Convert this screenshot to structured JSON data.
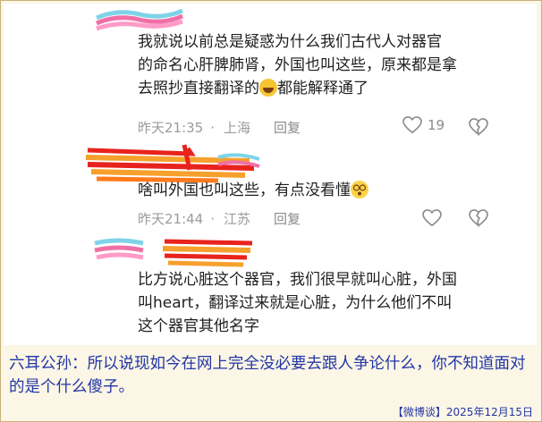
{
  "comments": [
    {
      "lines": [
        "我就说以前总是疑惑为什么我们古代人对器官",
        "的命名心肝脾肺肾，外国也叫这些，原来都是拿",
        "去照抄直接翻译的"
      ],
      "line3_tail": "都能解释通了",
      "time": "昨天21:35",
      "location": "上海",
      "reply": "回复",
      "likes": "19"
    },
    {
      "text": "啥叫外国也叫这些，有点没看懂",
      "time": "昨天21:44",
      "location": "江苏",
      "reply": "回复"
    },
    {
      "lines": [
        "比方说心脏这个器官，我们很早就叫心脏，外国",
        "叫heart，翻译过来就是心脏，为什么他们不叫",
        "这个器官其他名字"
      ]
    }
  ],
  "separator": "·",
  "caption": "六耳公孙：所以说现如今在网上完全没必要去跟人争论什么，你不知道面对的是个什么傻子。",
  "footer": "【微博谈】2025年12月15日",
  "icons": [
    "heart-icon",
    "broken-heart-icon",
    "laugh-emoji-icon",
    "dizzy-emoji-icon"
  ],
  "colors": {
    "caption_text": "#2336a6",
    "background": "#fbf6e6",
    "meta_text": "#9b9b9b"
  }
}
